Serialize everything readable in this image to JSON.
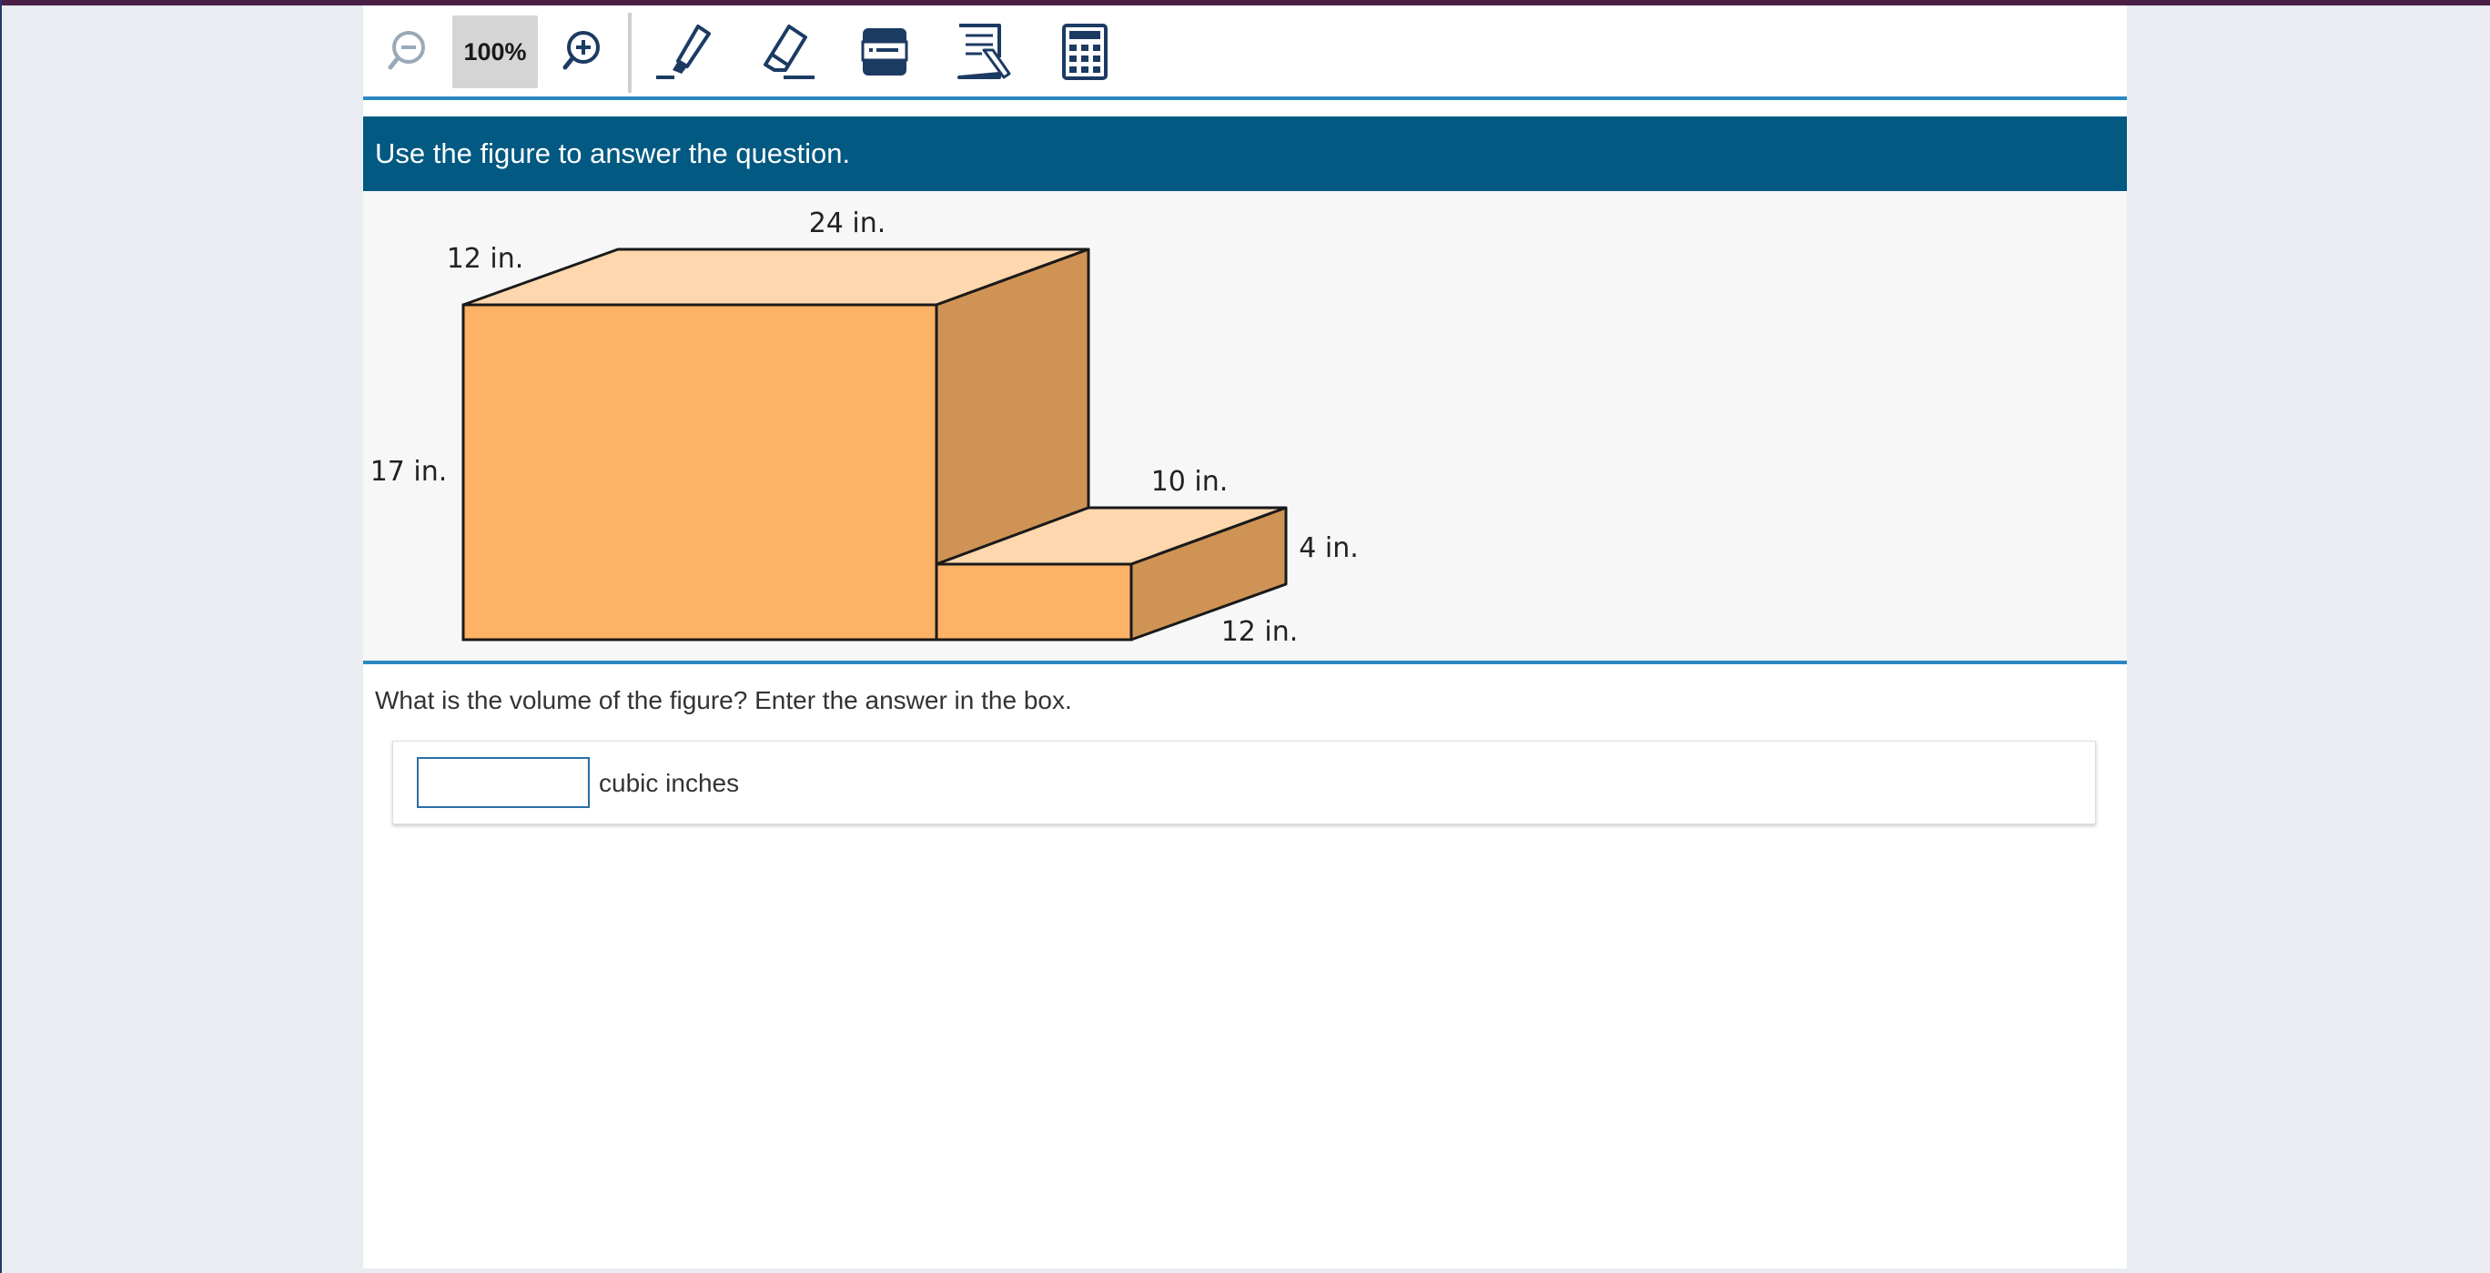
{
  "toolbar": {
    "zoom_level": "100%",
    "tools": [
      {
        "name": "zoom-out",
        "icon": "zoom-out-icon"
      },
      {
        "name": "zoom-in",
        "icon": "zoom-in-icon"
      },
      {
        "name": "highlighter",
        "icon": "highlighter-icon"
      },
      {
        "name": "eraser",
        "icon": "eraser-icon"
      },
      {
        "name": "line-reader",
        "icon": "line-reader-icon"
      },
      {
        "name": "notepad",
        "icon": "notepad-icon"
      },
      {
        "name": "calculator",
        "icon": "calculator-icon"
      }
    ]
  },
  "stimulus": {
    "header": "Use the figure to answer the question.",
    "figure": {
      "labels": {
        "top_length": "24 in.",
        "top_depth": "12 in.",
        "height": "17 in.",
        "step_width": "10 in.",
        "step_height": "4 in.",
        "step_depth": "12 in."
      }
    }
  },
  "question": {
    "prompt": "What is the volume of the figure? Enter the answer in the box.",
    "answer_value": "",
    "unit": "cubic inches"
  },
  "colors": {
    "header_bg": "#025982",
    "accent_line": "#2b87c2",
    "icon_navy": "#1c3b63",
    "box_front": "#feb266",
    "box_top": "#fed7ae",
    "box_side": "#cf9455"
  }
}
